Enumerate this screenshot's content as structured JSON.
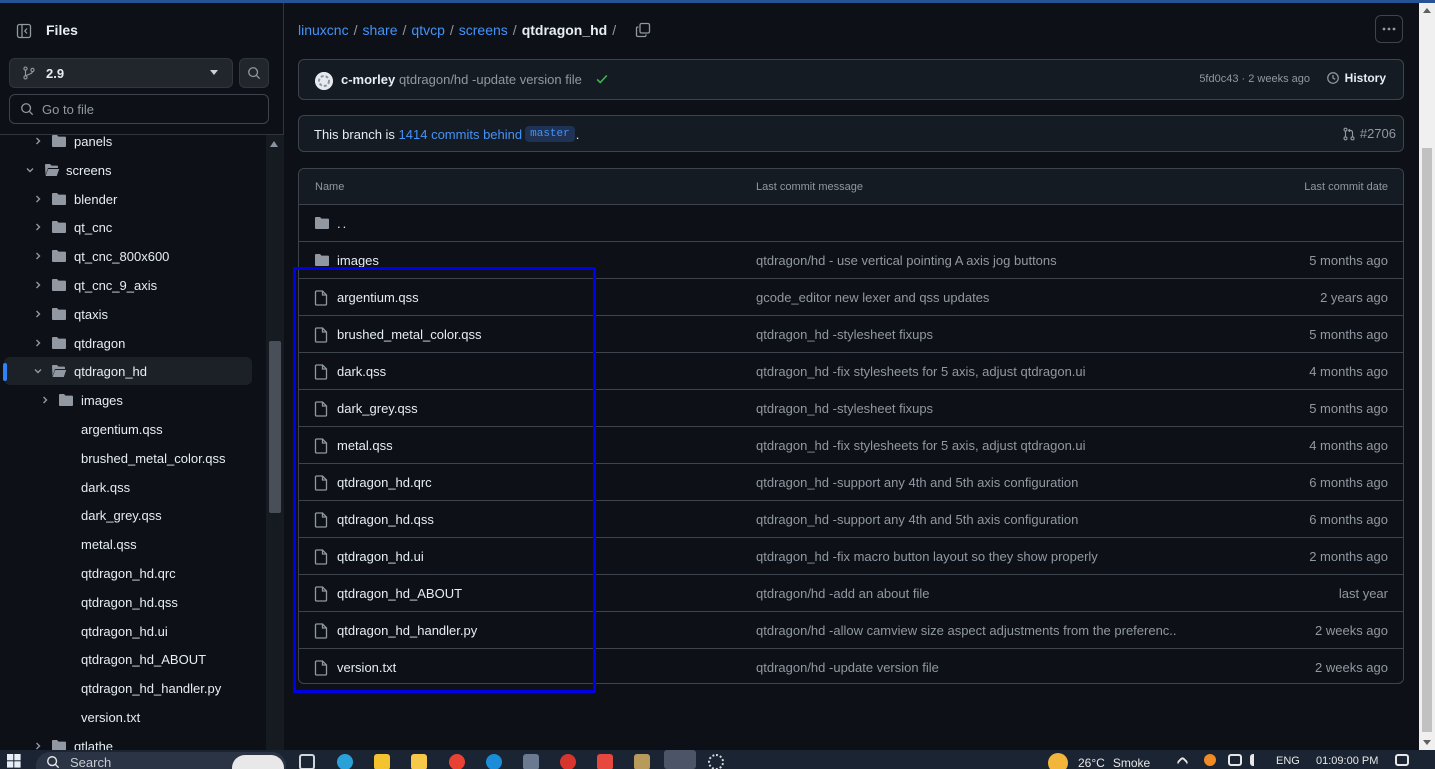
{
  "sidebar": {
    "title": "Files",
    "branch": "2.9",
    "goto_placeholder": "Go to file",
    "tree": [
      {
        "label": "panels",
        "type": "folder",
        "expanded": false,
        "depth": 1
      },
      {
        "label": "screens",
        "type": "folder",
        "expanded": true,
        "depth": 0
      },
      {
        "label": "blender",
        "type": "folder",
        "expanded": false,
        "depth": 1
      },
      {
        "label": "qt_cnc",
        "type": "folder",
        "expanded": false,
        "depth": 1
      },
      {
        "label": "qt_cnc_800x600",
        "type": "folder",
        "expanded": false,
        "depth": 1
      },
      {
        "label": "qt_cnc_9_axis",
        "type": "folder",
        "expanded": false,
        "depth": 1
      },
      {
        "label": "qtaxis",
        "type": "folder",
        "expanded": false,
        "depth": 1
      },
      {
        "label": "qtdragon",
        "type": "folder",
        "expanded": false,
        "depth": 1
      },
      {
        "label": "qtdragon_hd",
        "type": "folder",
        "expanded": true,
        "depth": 1,
        "selected": true
      },
      {
        "label": "images",
        "type": "folder",
        "expanded": false,
        "depth": 2
      },
      {
        "label": "argentium.qss",
        "type": "file",
        "depth": 2
      },
      {
        "label": "brushed_metal_color.qss",
        "type": "file",
        "depth": 2
      },
      {
        "label": "dark.qss",
        "type": "file",
        "depth": 2
      },
      {
        "label": "dark_grey.qss",
        "type": "file",
        "depth": 2
      },
      {
        "label": "metal.qss",
        "type": "file",
        "depth": 2
      },
      {
        "label": "qtdragon_hd.qrc",
        "type": "file",
        "depth": 2
      },
      {
        "label": "qtdragon_hd.qss",
        "type": "file",
        "depth": 2
      },
      {
        "label": "qtdragon_hd.ui",
        "type": "file",
        "depth": 2
      },
      {
        "label": "qtdragon_hd_ABOUT",
        "type": "file",
        "depth": 2
      },
      {
        "label": "qtdragon_hd_handler.py",
        "type": "file",
        "depth": 2
      },
      {
        "label": "version.txt",
        "type": "file",
        "depth": 2
      },
      {
        "label": "qtlathe",
        "type": "folder",
        "expanded": false,
        "depth": 1
      }
    ]
  },
  "breadcrumb": {
    "parts": [
      "linuxcnc",
      "share",
      "qtvcp",
      "screens"
    ],
    "current": "qtdragon_hd",
    "trailing_sep": "/"
  },
  "commit": {
    "author": "c-morley",
    "message": "qtdragon/hd -update version file",
    "sha_time": "5fd0c43 · 2 weeks ago",
    "history_label": "History"
  },
  "branch_status": {
    "prefix": "This branch is",
    "link": "1414 commits behind",
    "base": "master",
    "suffix": ".",
    "pr": "#2706"
  },
  "table": {
    "headers": {
      "name": "Name",
      "message": "Last commit message",
      "date": "Last commit date"
    },
    "parent": "..",
    "rows": [
      {
        "name": "images",
        "type": "folder",
        "message": "qtdragon/hd - use vertical pointing A axis jog buttons",
        "date": "5 months ago"
      },
      {
        "name": "argentium.qss",
        "type": "file",
        "message": "gcode_editor new lexer and qss updates",
        "date": "2 years ago"
      },
      {
        "name": "brushed_metal_color.qss",
        "type": "file",
        "message": "qtdragon_hd -stylesheet fixups",
        "date": "5 months ago"
      },
      {
        "name": "dark.qss",
        "type": "file",
        "message": "qtdragon_hd -fix stylesheets for 5 axis, adjust qtdragon.ui",
        "date": "4 months ago"
      },
      {
        "name": "dark_grey.qss",
        "type": "file",
        "message": "qtdragon_hd -stylesheet fixups",
        "date": "5 months ago"
      },
      {
        "name": "metal.qss",
        "type": "file",
        "message": "qtdragon_hd -fix stylesheets for 5 axis, adjust qtdragon.ui",
        "date": "4 months ago"
      },
      {
        "name": "qtdragon_hd.qrc",
        "type": "file",
        "message": "qtdragon_hd -support any 4th and 5th axis configuration",
        "date": "6 months ago"
      },
      {
        "name": "qtdragon_hd.qss",
        "type": "file",
        "message": "qtdragon_hd -support any 4th and 5th axis configuration",
        "date": "6 months ago"
      },
      {
        "name": "qtdragon_hd.ui",
        "type": "file",
        "message": "qtdragon_hd -fix macro button layout so they show properly",
        "date": "2 months ago"
      },
      {
        "name": "qtdragon_hd_ABOUT",
        "type": "file",
        "message": "qtdragon/hd -add an about file",
        "date": "last year"
      },
      {
        "name": "qtdragon_hd_handler.py",
        "type": "file",
        "message": "qtdragon/hd -allow camview size aspect adjustments from the preferenc...",
        "date": "2 weeks ago"
      },
      {
        "name": "version.txt",
        "type": "file",
        "message": "qtdragon/hd -update version file",
        "date": "2 weeks ago"
      }
    ]
  },
  "taskbar": {
    "search": "Search",
    "temperature": "26°C",
    "weather": "Smoke",
    "language": "ENG",
    "time": "01:09:00 PM"
  },
  "colors": {
    "background": "#0d1117",
    "link": "#4493f8",
    "highlight_box": "#0000e6",
    "success": "#3fb950"
  }
}
